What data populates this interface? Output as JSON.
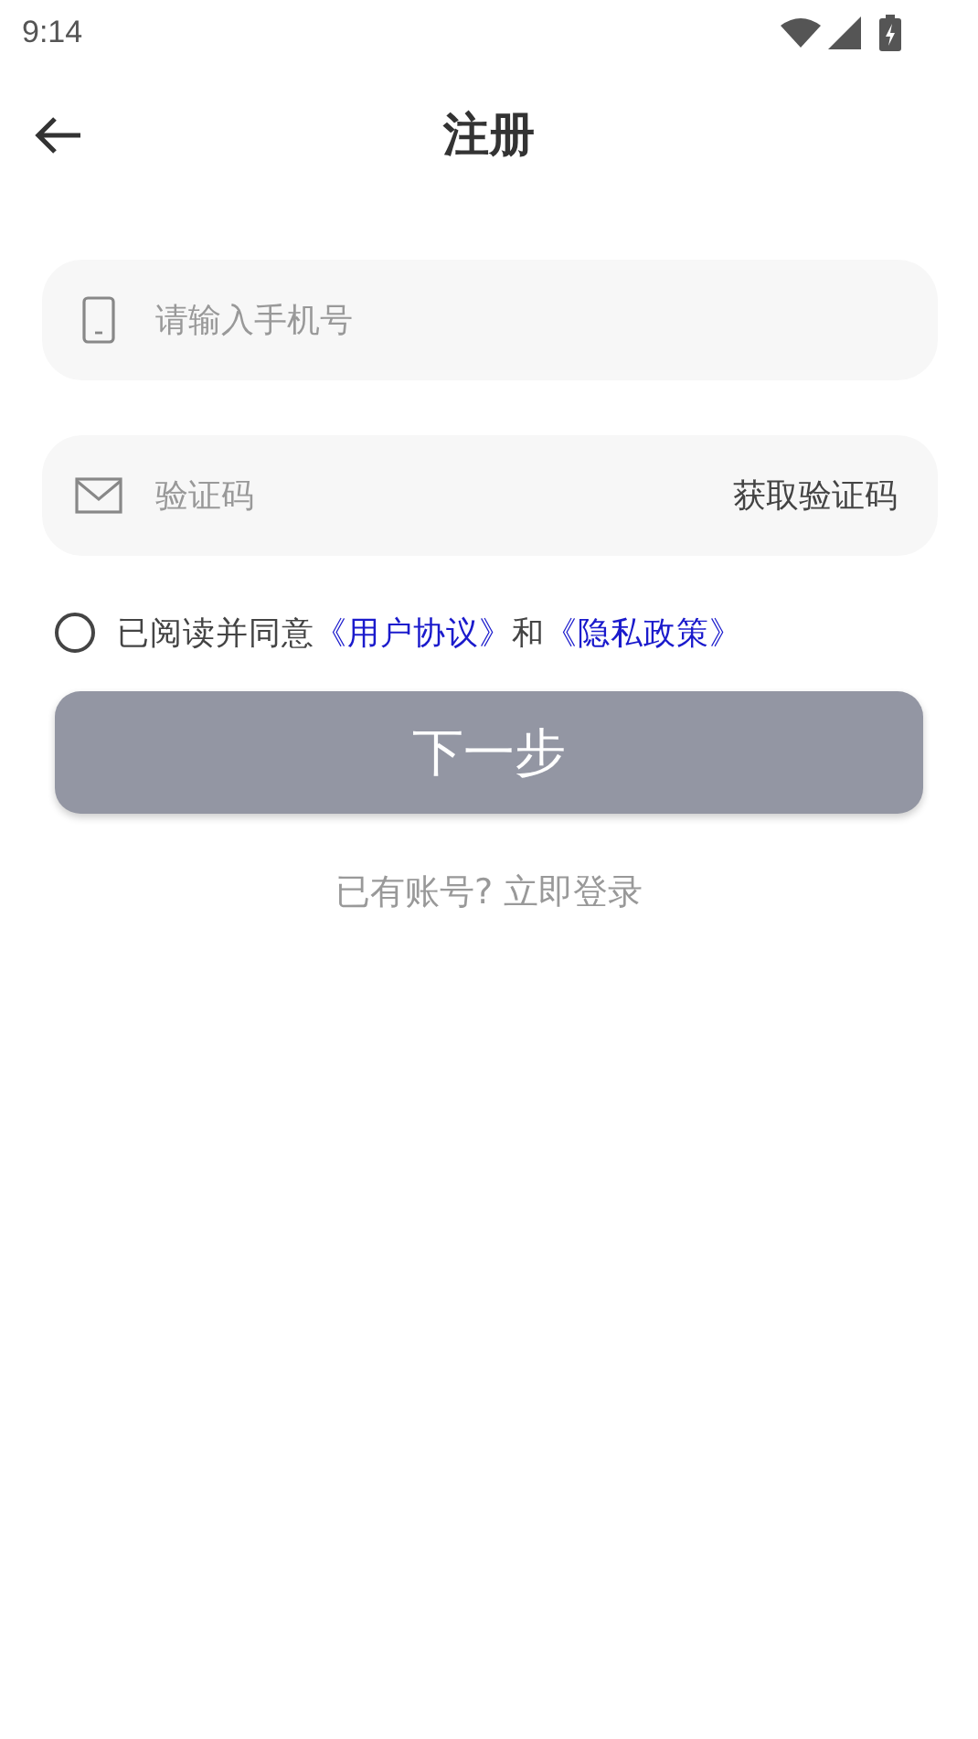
{
  "status_bar": {
    "time": "9:14"
  },
  "header": {
    "title": "注册"
  },
  "fields": [
    {
      "kind": "phone",
      "placeholder": "请输入手机号"
    },
    {
      "kind": "code",
      "placeholder": "验证码",
      "action": "获取验证码"
    }
  ],
  "agreement": {
    "checked": false,
    "parts": [
      {
        "kind": "text",
        "text": "已阅读并同意"
      },
      {
        "kind": "link",
        "text": "《用户协议》"
      },
      {
        "kind": "text",
        "text": "和"
      },
      {
        "kind": "link",
        "text": "《隐私政策》"
      }
    ]
  },
  "next_button": {
    "label": "下一步",
    "disabled": true
  },
  "login_link": {
    "text": "已有账号? 立即登录"
  }
}
